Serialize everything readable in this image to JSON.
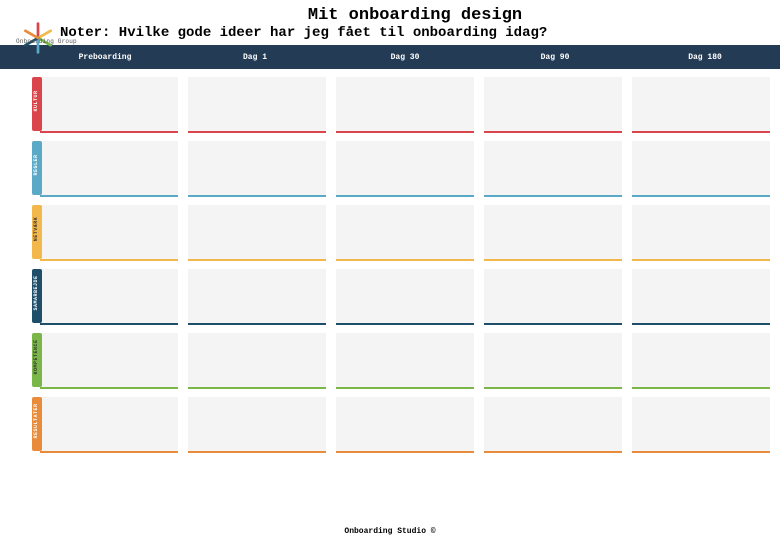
{
  "header": {
    "title": "Mit onboarding design",
    "subtitle": "Noter: Hvilke gode ideer har jeg fået til onboarding idag?",
    "brand": "Onboarding Group"
  },
  "days": [
    "Preboarding",
    "Dag 1",
    "Dag 30",
    "Dag 90",
    "Dag 180"
  ],
  "rows": [
    {
      "label": "KULTUR",
      "color": "#d9454a"
    },
    {
      "label": "REGLER",
      "color": "#5aa9c7"
    },
    {
      "label": "NETVÆRK",
      "color": "#f2b84b"
    },
    {
      "label": "SAMARBEJDE",
      "color": "#1f4e6b"
    },
    {
      "label": "KOMPETENCE",
      "color": "#7ab648"
    },
    {
      "label": "RESULTATER",
      "color": "#e88b3a"
    }
  ],
  "footer": "Onboarding Studio ©"
}
